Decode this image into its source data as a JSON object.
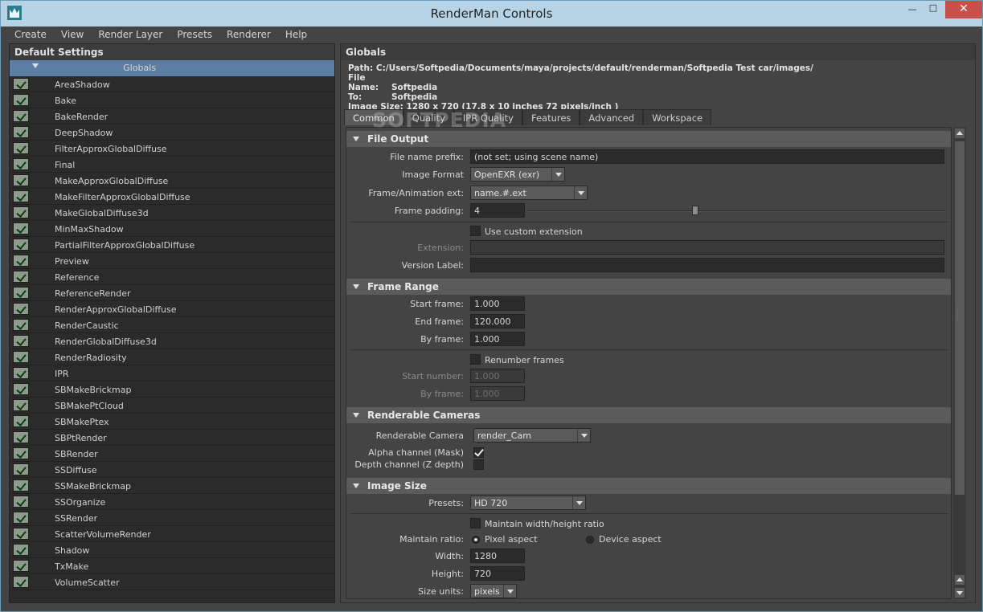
{
  "window": {
    "title": "RenderMan Controls"
  },
  "menu": [
    "Create",
    "View",
    "Render Layer",
    "Presets",
    "Renderer",
    "Help"
  ],
  "left_panel": {
    "header": "Default Settings",
    "root": "Globals",
    "items": [
      "AreaShadow",
      "Bake",
      "BakeRender",
      "DeepShadow",
      "FilterApproxGlobalDiffuse",
      "Final",
      "MakeApproxGlobalDiffuse",
      "MakeFilterApproxGlobalDiffuse",
      "MakeGlobalDiffuse3d",
      "MinMaxShadow",
      "PartialFilterApproxGlobalDiffuse",
      "Preview",
      "Reference",
      "ReferenceRender",
      "RenderApproxGlobalDiffuse",
      "RenderCaustic",
      "RenderGlobalDiffuse3d",
      "RenderRadiosity",
      "IPR",
      "SBMakeBrickmap",
      "SBMakePtCloud",
      "SBMakePtex",
      "SBPtRender",
      "SBRender",
      "SSDiffuse",
      "SSMakeBrickmap",
      "SSOrganize",
      "SSRender",
      "ScatterVolumeRender",
      "Shadow",
      "TxMake",
      "VolumeScatter"
    ]
  },
  "right_panel": {
    "header": "Globals",
    "path_label": "Path:",
    "path_value": "C:/Users/Softpedia/Documents/maya/projects/default/renderman/Softpedia Test car/images/",
    "filename_label": "File Name:",
    "filename_value": "Softpedia",
    "to_label": "To:",
    "to_value": "Softpedia",
    "imagesize_label": "Image Size:",
    "imagesize_value": "1280 x 720 (17.8 x 10 inches 72 pixels/inch )",
    "tabs": [
      "Common",
      "Quality",
      "IPR Quality",
      "Features",
      "Advanced",
      "Workspace"
    ],
    "watermark": "SOFTPEDIA"
  },
  "file_output": {
    "title": "File Output",
    "prefix_label": "File name prefix:",
    "prefix_value": "(not set; using scene name)",
    "format_label": "Image Format",
    "format_value": "OpenEXR (exr)",
    "ext_label": "Frame/Animation ext:",
    "ext_value": "name.#.ext",
    "padding_label": "Frame padding:",
    "padding_value": "4",
    "custom_ext_label": "Use custom extension",
    "extension_label": "Extension:",
    "version_label": "Version Label:"
  },
  "frame_range": {
    "title": "Frame Range",
    "start_label": "Start frame:",
    "start_value": "1.000",
    "end_label": "End frame:",
    "end_value": "120.000",
    "by_label": "By frame:",
    "by_value": "1.000",
    "renumber_label": "Renumber frames",
    "start_number_label": "Start number:",
    "start_number_value": "1.000",
    "by_frame2_label": "By frame:",
    "by_frame2_value": "1.000"
  },
  "renderable_cameras": {
    "title": "Renderable Cameras",
    "camera_label": "Renderable Camera",
    "camera_value": "render_Cam",
    "alpha_label": "Alpha channel (Mask)",
    "depth_label": "Depth channel (Z depth)"
  },
  "image_size": {
    "title": "Image Size",
    "presets_label": "Presets:",
    "presets_value": "HD 720",
    "maintain_wh_label": "Maintain width/height ratio",
    "maintain_ratio_label": "Maintain ratio:",
    "pixel_aspect_label": "Pixel aspect",
    "device_aspect_label": "Device aspect",
    "width_label": "Width:",
    "width_value": "1280",
    "height_label": "Height:",
    "height_value": "720",
    "units_label": "Size units:",
    "units_value": "pixels"
  },
  "colors": {
    "accent": "#5d7da3",
    "panel": "#444444",
    "field": "#2b2b2b"
  }
}
